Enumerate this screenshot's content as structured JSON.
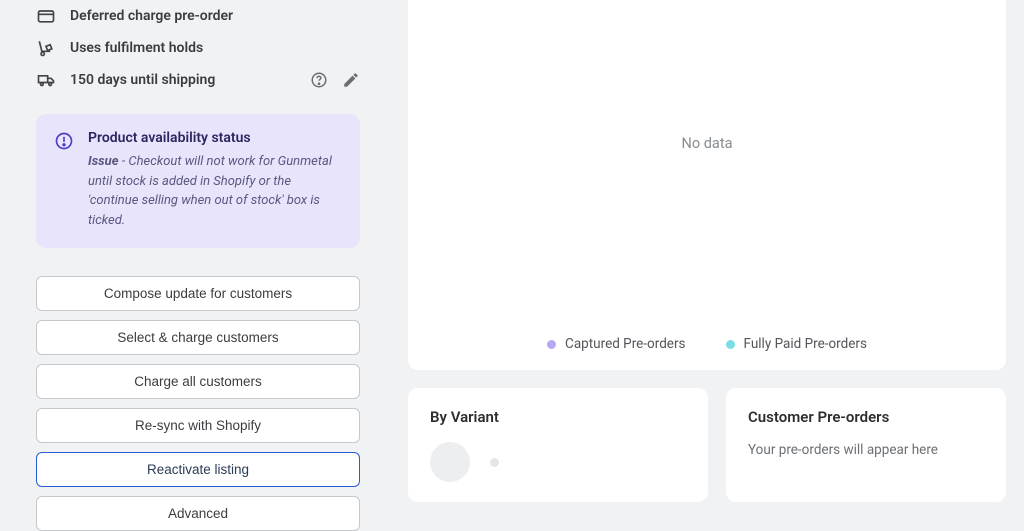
{
  "sidebar": {
    "features": [
      {
        "label": "Deferred charge pre-order"
      },
      {
        "label": "Uses fulfilment holds"
      },
      {
        "label": "150 days until shipping"
      }
    ],
    "alert": {
      "title": "Product availability status",
      "issue_label": "Issue",
      "body": " - Checkout will not work for Gunmetal until stock is added in Shopify or the 'continue selling when out of stock' box is ticked."
    },
    "actions": {
      "compose": "Compose update for customers",
      "select_charge": "Select & charge customers",
      "charge_all": "Charge all customers",
      "resync": "Re-sync with Shopify",
      "reactivate": "Reactivate listing",
      "advanced": "Advanced"
    }
  },
  "chart": {
    "no_data": "No data",
    "legend": {
      "captured": "Captured Pre-orders",
      "paid": "Fully Paid Pre-orders"
    }
  },
  "cards": {
    "by_variant": {
      "title": "By Variant"
    },
    "customer_preorders": {
      "title": "Customer Pre-orders",
      "empty": "Your pre-orders will appear here"
    }
  },
  "chart_data": {
    "type": "line",
    "series": [
      {
        "name": "Captured Pre-orders",
        "values": []
      },
      {
        "name": "Fully Paid Pre-orders",
        "values": []
      }
    ],
    "x": [],
    "note": "No data"
  }
}
